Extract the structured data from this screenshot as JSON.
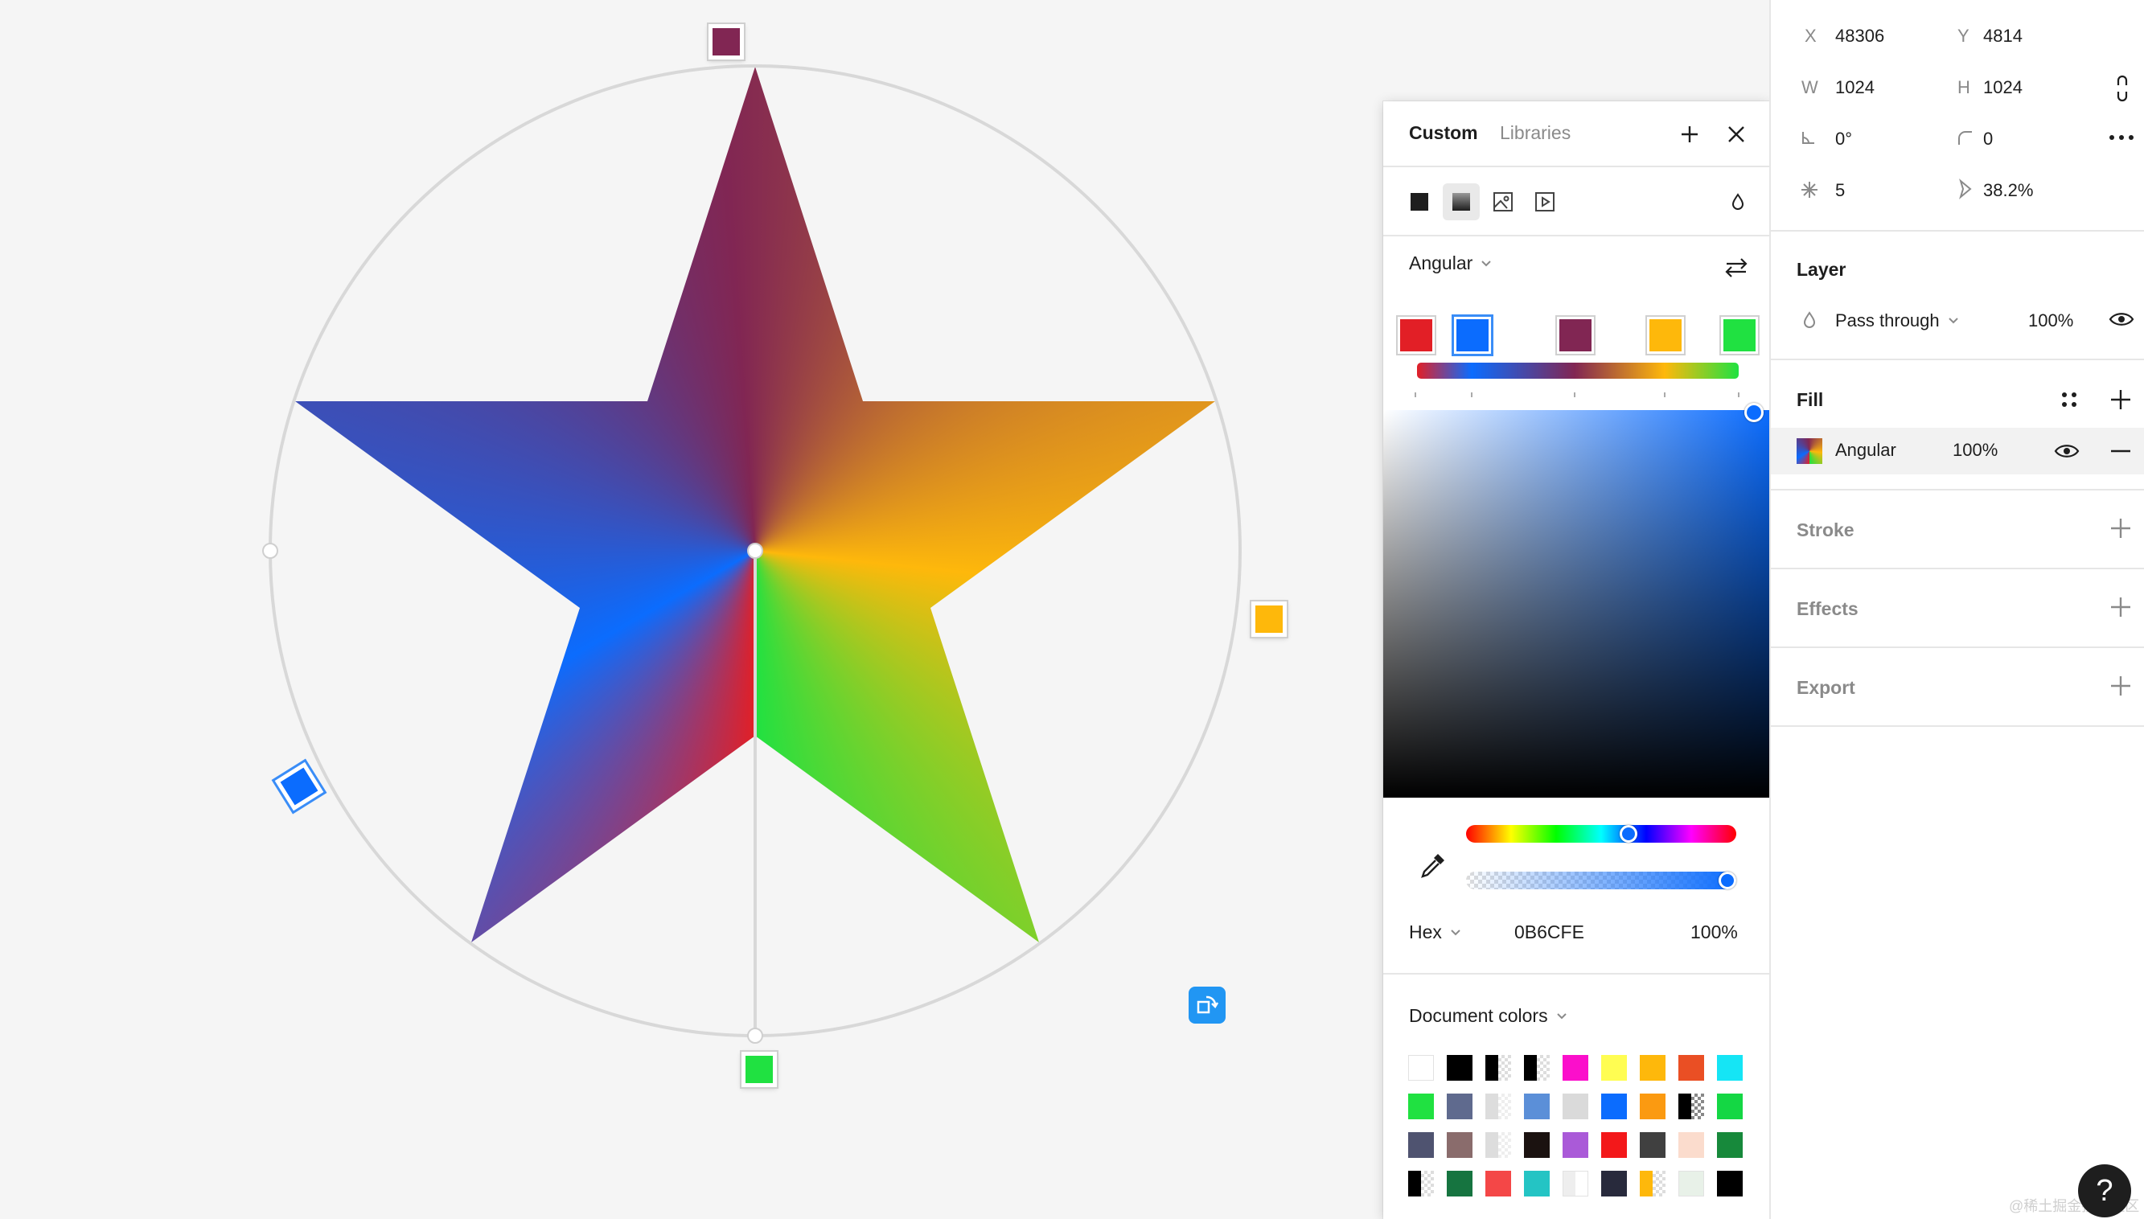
{
  "colors": {
    "stop_1": "#e21f26",
    "stop_2": "#0b6cfe",
    "stop_3": "#812653",
    "stop_4": "#feb80b",
    "stop_5": "#20e141",
    "accent": "#3a8df7",
    "rotate_tool": "#2196f3"
  },
  "picker": {
    "tabs": [
      "Custom",
      "Libraries"
    ],
    "active_tab": "Custom",
    "fill_types": [
      "solid-icon",
      "gradient-icon",
      "image-icon",
      "video-icon"
    ],
    "active_fill_type": "gradient-icon",
    "gradient_type": "Angular",
    "color_format": "Hex",
    "hex_value": "0B6CFE",
    "hex_opacity": "100%",
    "hue_position": 0.6,
    "alpha_value": 1.0,
    "document_colors_label": "Document colors",
    "document_colors": [
      "#ffffff",
      "#000000",
      "#000000|#dddddd",
      "#000000|#dddddd",
      "#fb0fcb",
      "#fffd52",
      "#feb80b",
      "#ea4f24",
      "#15e5f5",
      "#20e141",
      "#5f6a8e",
      "#dddddd|#eeeeee",
      "#5b8fd8",
      "#dadada",
      "#0b6cfe",
      "#fb9a11",
      "#000000|#888888",
      "#14d744",
      "#4f5370",
      "#8a6c6c",
      "#dddddd|#eeeeee",
      "#1b1210",
      "#aa5ad8",
      "#f3181a",
      "#404040",
      "#fbdccd",
      "#17893b",
      "#000000|#dddddd",
      "#167440",
      "#f44747",
      "#24c4c4",
      "#eeeeee|#ffffff",
      "#282a3c",
      "#feb80b|#dddddd",
      "#e8f1e8",
      "#000000"
    ]
  },
  "panel": {
    "x_label": "X",
    "x_value": "48306",
    "y_label": "Y",
    "y_value": "4814",
    "w_label": "W",
    "w_value": "1024",
    "h_label": "H",
    "h_value": "1024",
    "rotation": "0°",
    "corner_radius": "0",
    "points": "5",
    "ratio": "38.2%",
    "layer_title": "Layer",
    "blend_mode": "Pass through",
    "layer_opacity": "100%",
    "fill_title": "Fill",
    "fill_name": "Angular",
    "fill_opacity": "100%",
    "stroke_title": "Stroke",
    "effects_title": "Effects",
    "export_title": "Export"
  },
  "help_label": "?",
  "watermark": "@稀土掘金技术社区"
}
